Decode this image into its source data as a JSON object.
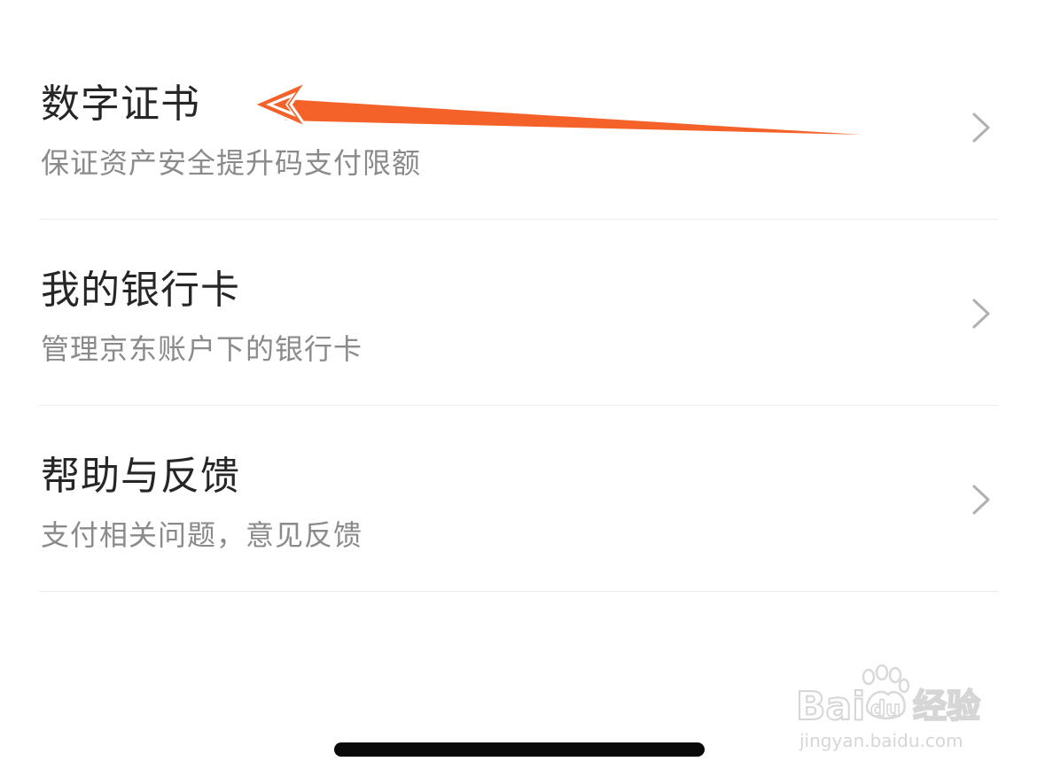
{
  "menu": {
    "items": [
      {
        "title": "数字证书",
        "subtitle": "保证资产安全提升码支付限额"
      },
      {
        "title": "我的银行卡",
        "subtitle": "管理京东账户下的银行卡"
      },
      {
        "title": "帮助与反馈",
        "subtitle": "支付相关问题，意见反馈"
      }
    ]
  },
  "annotation": {
    "arrow_color": "#f4622a",
    "arrow_points_to": "数字证书"
  },
  "watermark": {
    "logo_text": "Baidu经验",
    "url": "jingyan.baidu.com"
  },
  "colors": {
    "title": "#262626",
    "subtitle": "#8a8a8a",
    "chevron": "#b0b0b0",
    "divider": "#ececec"
  }
}
